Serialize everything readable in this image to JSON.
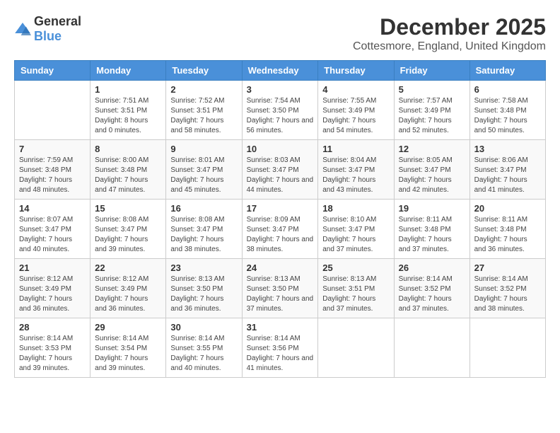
{
  "logo": {
    "text_general": "General",
    "text_blue": "Blue"
  },
  "header": {
    "month": "December 2025",
    "location": "Cottesmore, England, United Kingdom"
  },
  "days_of_week": [
    "Sunday",
    "Monday",
    "Tuesday",
    "Wednesday",
    "Thursday",
    "Friday",
    "Saturday"
  ],
  "weeks": [
    [
      {
        "day": "",
        "sunrise": "",
        "sunset": "",
        "daylight": ""
      },
      {
        "day": "1",
        "sunrise": "Sunrise: 7:51 AM",
        "sunset": "Sunset: 3:51 PM",
        "daylight": "Daylight: 8 hours and 0 minutes."
      },
      {
        "day": "2",
        "sunrise": "Sunrise: 7:52 AM",
        "sunset": "Sunset: 3:51 PM",
        "daylight": "Daylight: 7 hours and 58 minutes."
      },
      {
        "day": "3",
        "sunrise": "Sunrise: 7:54 AM",
        "sunset": "Sunset: 3:50 PM",
        "daylight": "Daylight: 7 hours and 56 minutes."
      },
      {
        "day": "4",
        "sunrise": "Sunrise: 7:55 AM",
        "sunset": "Sunset: 3:49 PM",
        "daylight": "Daylight: 7 hours and 54 minutes."
      },
      {
        "day": "5",
        "sunrise": "Sunrise: 7:57 AM",
        "sunset": "Sunset: 3:49 PM",
        "daylight": "Daylight: 7 hours and 52 minutes."
      },
      {
        "day": "6",
        "sunrise": "Sunrise: 7:58 AM",
        "sunset": "Sunset: 3:48 PM",
        "daylight": "Daylight: 7 hours and 50 minutes."
      }
    ],
    [
      {
        "day": "7",
        "sunrise": "Sunrise: 7:59 AM",
        "sunset": "Sunset: 3:48 PM",
        "daylight": "Daylight: 7 hours and 48 minutes."
      },
      {
        "day": "8",
        "sunrise": "Sunrise: 8:00 AM",
        "sunset": "Sunset: 3:48 PM",
        "daylight": "Daylight: 7 hours and 47 minutes."
      },
      {
        "day": "9",
        "sunrise": "Sunrise: 8:01 AM",
        "sunset": "Sunset: 3:47 PM",
        "daylight": "Daylight: 7 hours and 45 minutes."
      },
      {
        "day": "10",
        "sunrise": "Sunrise: 8:03 AM",
        "sunset": "Sunset: 3:47 PM",
        "daylight": "Daylight: 7 hours and 44 minutes."
      },
      {
        "day": "11",
        "sunrise": "Sunrise: 8:04 AM",
        "sunset": "Sunset: 3:47 PM",
        "daylight": "Daylight: 7 hours and 43 minutes."
      },
      {
        "day": "12",
        "sunrise": "Sunrise: 8:05 AM",
        "sunset": "Sunset: 3:47 PM",
        "daylight": "Daylight: 7 hours and 42 minutes."
      },
      {
        "day": "13",
        "sunrise": "Sunrise: 8:06 AM",
        "sunset": "Sunset: 3:47 PM",
        "daylight": "Daylight: 7 hours and 41 minutes."
      }
    ],
    [
      {
        "day": "14",
        "sunrise": "Sunrise: 8:07 AM",
        "sunset": "Sunset: 3:47 PM",
        "daylight": "Daylight: 7 hours and 40 minutes."
      },
      {
        "day": "15",
        "sunrise": "Sunrise: 8:08 AM",
        "sunset": "Sunset: 3:47 PM",
        "daylight": "Daylight: 7 hours and 39 minutes."
      },
      {
        "day": "16",
        "sunrise": "Sunrise: 8:08 AM",
        "sunset": "Sunset: 3:47 PM",
        "daylight": "Daylight: 7 hours and 38 minutes."
      },
      {
        "day": "17",
        "sunrise": "Sunrise: 8:09 AM",
        "sunset": "Sunset: 3:47 PM",
        "daylight": "Daylight: 7 hours and 38 minutes."
      },
      {
        "day": "18",
        "sunrise": "Sunrise: 8:10 AM",
        "sunset": "Sunset: 3:47 PM",
        "daylight": "Daylight: 7 hours and 37 minutes."
      },
      {
        "day": "19",
        "sunrise": "Sunrise: 8:11 AM",
        "sunset": "Sunset: 3:48 PM",
        "daylight": "Daylight: 7 hours and 37 minutes."
      },
      {
        "day": "20",
        "sunrise": "Sunrise: 8:11 AM",
        "sunset": "Sunset: 3:48 PM",
        "daylight": "Daylight: 7 hours and 36 minutes."
      }
    ],
    [
      {
        "day": "21",
        "sunrise": "Sunrise: 8:12 AM",
        "sunset": "Sunset: 3:49 PM",
        "daylight": "Daylight: 7 hours and 36 minutes."
      },
      {
        "day": "22",
        "sunrise": "Sunrise: 8:12 AM",
        "sunset": "Sunset: 3:49 PM",
        "daylight": "Daylight: 7 hours and 36 minutes."
      },
      {
        "day": "23",
        "sunrise": "Sunrise: 8:13 AM",
        "sunset": "Sunset: 3:50 PM",
        "daylight": "Daylight: 7 hours and 36 minutes."
      },
      {
        "day": "24",
        "sunrise": "Sunrise: 8:13 AM",
        "sunset": "Sunset: 3:50 PM",
        "daylight": "Daylight: 7 hours and 37 minutes."
      },
      {
        "day": "25",
        "sunrise": "Sunrise: 8:13 AM",
        "sunset": "Sunset: 3:51 PM",
        "daylight": "Daylight: 7 hours and 37 minutes."
      },
      {
        "day": "26",
        "sunrise": "Sunrise: 8:14 AM",
        "sunset": "Sunset: 3:52 PM",
        "daylight": "Daylight: 7 hours and 37 minutes."
      },
      {
        "day": "27",
        "sunrise": "Sunrise: 8:14 AM",
        "sunset": "Sunset: 3:52 PM",
        "daylight": "Daylight: 7 hours and 38 minutes."
      }
    ],
    [
      {
        "day": "28",
        "sunrise": "Sunrise: 8:14 AM",
        "sunset": "Sunset: 3:53 PM",
        "daylight": "Daylight: 7 hours and 39 minutes."
      },
      {
        "day": "29",
        "sunrise": "Sunrise: 8:14 AM",
        "sunset": "Sunset: 3:54 PM",
        "daylight": "Daylight: 7 hours and 39 minutes."
      },
      {
        "day": "30",
        "sunrise": "Sunrise: 8:14 AM",
        "sunset": "Sunset: 3:55 PM",
        "daylight": "Daylight: 7 hours and 40 minutes."
      },
      {
        "day": "31",
        "sunrise": "Sunrise: 8:14 AM",
        "sunset": "Sunset: 3:56 PM",
        "daylight": "Daylight: 7 hours and 41 minutes."
      },
      {
        "day": "",
        "sunrise": "",
        "sunset": "",
        "daylight": ""
      },
      {
        "day": "",
        "sunrise": "",
        "sunset": "",
        "daylight": ""
      },
      {
        "day": "",
        "sunrise": "",
        "sunset": "",
        "daylight": ""
      }
    ]
  ]
}
